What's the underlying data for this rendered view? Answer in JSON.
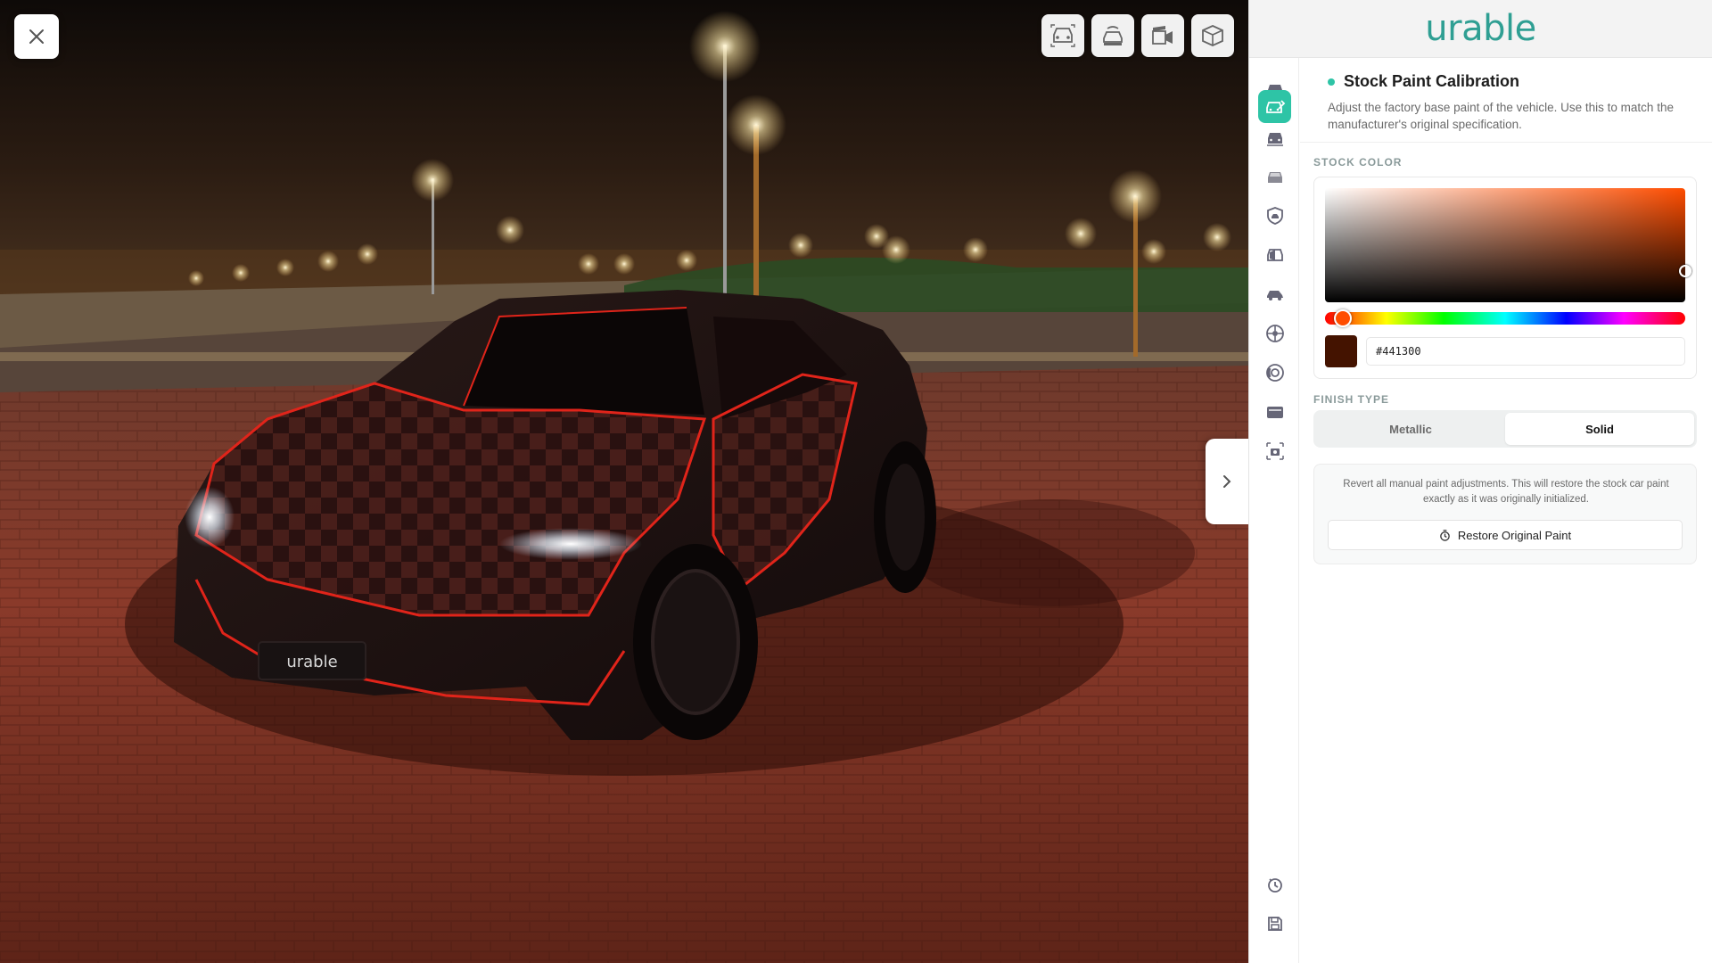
{
  "scene": {
    "plate_text": "urable",
    "paint_color": "#441300"
  },
  "view_toolbar": [
    {
      "icon": "car-front-view-icon"
    },
    {
      "icon": "car-top-view-icon"
    },
    {
      "icon": "video-camera-icon"
    },
    {
      "icon": "cube-3d-icon"
    }
  ],
  "brand": {
    "logo_text": "urable",
    "color": "#2f9f93"
  },
  "rail": {
    "items": [
      {
        "icon": "car-icon",
        "active": false
      },
      {
        "icon": "car-paint-icon",
        "active": true
      },
      {
        "icon": "car-detail-icon",
        "active": false
      },
      {
        "icon": "car-tint-icon",
        "active": false
      },
      {
        "icon": "shield-icon",
        "active": false
      },
      {
        "icon": "car-wrap-icon",
        "active": false
      },
      {
        "icon": "car-side-icon",
        "active": false
      },
      {
        "icon": "wheel-icon",
        "active": false
      },
      {
        "icon": "brake-icon",
        "active": false
      },
      {
        "icon": "decal-icon",
        "active": false
      },
      {
        "icon": "camera-icon",
        "active": false
      }
    ],
    "bottom": [
      {
        "icon": "history-icon"
      },
      {
        "icon": "save-icon"
      }
    ],
    "accent": "#2ec4a6"
  },
  "panel": {
    "title": "Stock Paint Calibration",
    "description": "Adjust the factory base paint of the vehicle. Use this to match the manufacturer's original specification.",
    "stock_color_label": "STOCK COLOR",
    "picker": {
      "hue": 18,
      "saturation": 1.0,
      "value": 0.27,
      "hex_value": "#441300",
      "swatch_color": "#441300"
    },
    "finish_label": "FINISH TYPE",
    "finish_options": [
      "Metallic",
      "Solid"
    ],
    "finish_selected": "Solid",
    "restore_text": "Revert all manual paint adjustments. This will restore the stock car paint exactly as it was originally initialized.",
    "restore_button": "Restore Original Paint"
  }
}
